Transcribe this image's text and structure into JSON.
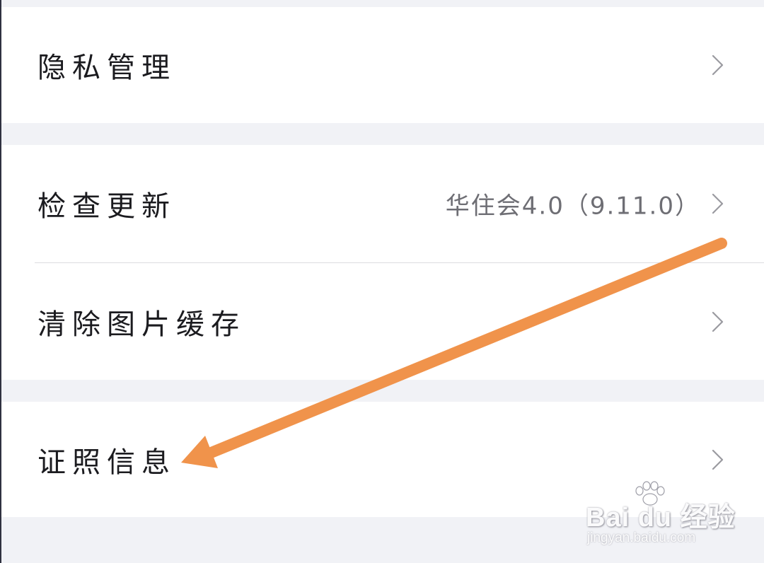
{
  "settings": {
    "privacy": {
      "label": "隐私管理"
    },
    "check_update": {
      "label": "检查更新",
      "value": "华住会4.0（9.11.0）"
    },
    "clear_cache": {
      "label": "清除图片缓存"
    },
    "license_info": {
      "label": "证照信息"
    }
  },
  "annotation": {
    "arrow_color": "#f0934b"
  },
  "watermark": {
    "brand": "Bai du 经验",
    "url": "jingyan.baidu.com"
  },
  "icons": {
    "row_chevron": "chevron-right-icon"
  }
}
